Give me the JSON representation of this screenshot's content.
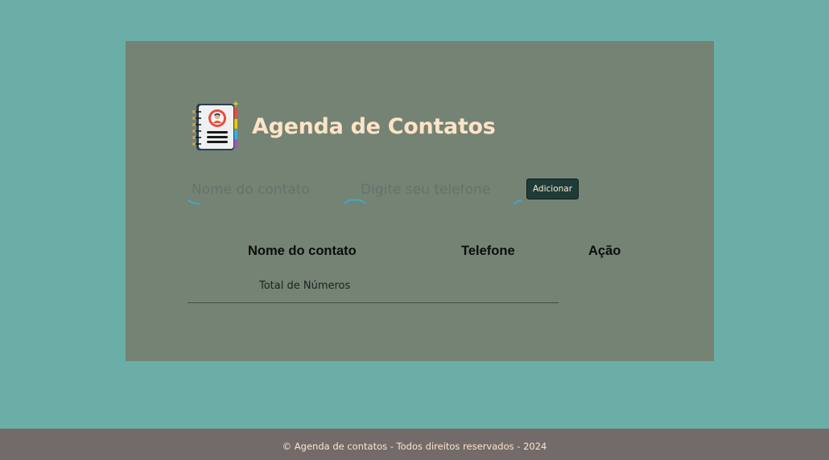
{
  "header": {
    "title": "Agenda de Contatos",
    "logo_icon": "address-book-icon"
  },
  "form": {
    "name_placeholder": "Nome do contato",
    "phone_placeholder": "Digite seu telefone",
    "add_label": "Adicionar"
  },
  "table": {
    "columns": [
      "Nome do contato",
      "Telefone",
      "Ação"
    ],
    "total_label": "Total de Números"
  },
  "footer": {
    "text": "© Agenda de contatos - Todos direitos reservados - 2024"
  },
  "colors": {
    "page_background": "#6aaea7",
    "card_background": "#748374",
    "title": "#fde3c7",
    "button": "#1f3b37",
    "footer_background": "#736b69"
  }
}
